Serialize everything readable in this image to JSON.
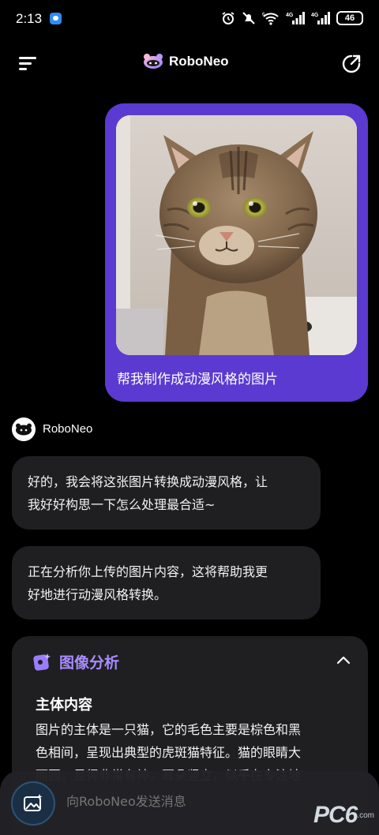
{
  "status_bar": {
    "time": "2:13",
    "battery": "46",
    "icons": [
      "chat-notification-icon",
      "alarm-icon",
      "mute-icon",
      "wifi-6-icon",
      "4g-signal-icon",
      "4g-signal-icon",
      "battery-icon"
    ]
  },
  "header": {
    "brand_name": "RoboNeo",
    "menu_icon": "hamburger-menu-icon",
    "share_icon": "share-icon"
  },
  "chat": {
    "user_message": {
      "image": "tabby-cat-photo",
      "text": "帮我制作成动漫风格的图片"
    },
    "bot_name": "RoboNeo",
    "bot_messages": [
      {
        "line1": "好的，我会将这张图片转换成动漫风格，让",
        "line2": "我好好构思一下怎么处理最合适~"
      },
      {
        "line1": "正在分析你上传的图片内容，这将帮助我更",
        "line2": "好地进行动漫风格转换。"
      }
    ],
    "analysis_card": {
      "title": "图像分析",
      "section_title": "主体内容",
      "body_lines": [
        "图片的主体是一只猫，它的毛色主要是棕色和黑",
        "色相间，呈现出典型的虎斑猫特征。猫的眼睛大",
        "而圆，显得非常有神，耳朵竖立，似乎在专注地"
      ]
    }
  },
  "input": {
    "placeholder": "向RoboNeo发送消息",
    "image_button_icon": "image-upload-icon"
  },
  "watermark": {
    "text": "PC6",
    "sub": ".com"
  },
  "colors": {
    "background": "#000000",
    "user_bubble": "#5b3ad1",
    "bot_bubble": "#1f1f21",
    "accent": "#a98cff"
  }
}
